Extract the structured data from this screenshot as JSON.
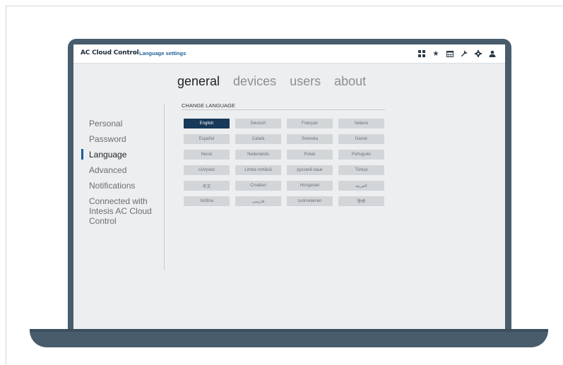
{
  "app": {
    "title": "AC Cloud Control",
    "separator": "-",
    "subtitle": "Language settings"
  },
  "toolbar_icons": [
    "dashboard-icon",
    "star-icon",
    "calendar-icon",
    "wrench-icon",
    "gear-icon",
    "user-icon"
  ],
  "main_tabs": [
    {
      "label": "general",
      "active": true
    },
    {
      "label": "devices",
      "active": false
    },
    {
      "label": "users",
      "active": false
    },
    {
      "label": "about",
      "active": false
    }
  ],
  "sidebar": {
    "items": [
      {
        "label": "Personal",
        "active": false
      },
      {
        "label": "Password",
        "active": false
      },
      {
        "label": "Language",
        "active": true
      },
      {
        "label": "Advanced",
        "active": false
      },
      {
        "label": "Notifications",
        "active": false
      },
      {
        "label": "Connected with Intesis AC Cloud Control",
        "active": false
      }
    ]
  },
  "language": {
    "section_title": "CHANGE LANGUAGE",
    "selected": "English",
    "options": [
      "English",
      "Deutsch",
      "Français",
      "Italiano",
      "Español",
      "Català",
      "Svenska",
      "Dansk",
      "Norsk",
      "Nederlands",
      "Polski",
      "Português",
      "ελληνικά",
      "Limba română",
      "русский язык",
      "Türkçe",
      "中文",
      "Croatian",
      "Hungarian",
      "العربية",
      "čeština",
      "فارسی",
      "suomalainen",
      "हिन्दी"
    ]
  },
  "colors": {
    "frame": "#485c6c",
    "accent": "#1e5f9a",
    "selected_button": "#17395a",
    "screen_bg": "#eceef0"
  }
}
